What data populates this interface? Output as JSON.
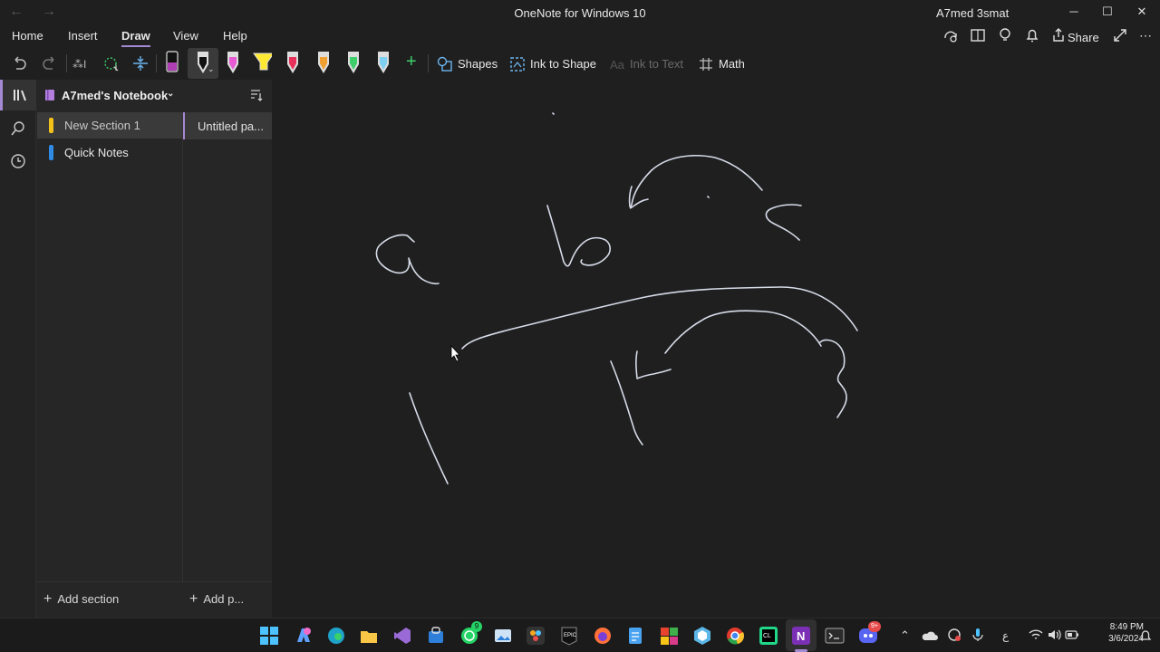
{
  "window": {
    "title": "OneNote for Windows 10",
    "user": "A7med 3smat",
    "back": "←",
    "forward": "→",
    "minimize": "─",
    "maximize": "☐",
    "close": "✕"
  },
  "menu": {
    "tabs": [
      "Home",
      "Insert",
      "Draw",
      "View",
      "Help"
    ],
    "active": "Draw",
    "share_label": "Share"
  },
  "toolbar": {
    "shapes_label": "Shapes",
    "ink_to_shape_label": "Ink to Shape",
    "ink_to_text_label": "Ink to Text",
    "math_label": "Math",
    "pens": [
      {
        "name": "pen-black-purple",
        "color": "#b03fb5"
      },
      {
        "name": "pen-black",
        "color": "#111111"
      },
      {
        "name": "pen-pink",
        "color": "#e85ad4"
      },
      {
        "name": "highlighter-yellow",
        "color": "#ffe933"
      },
      {
        "name": "pen-red",
        "color": "#e8315a"
      },
      {
        "name": "pen-orange",
        "color": "#f0a030"
      },
      {
        "name": "pen-green",
        "color": "#3fcf6a"
      },
      {
        "name": "pen-light-blue",
        "color": "#7fd0f0"
      }
    ]
  },
  "sidebar": {
    "notebook_name": "A7med's Notebook",
    "sections": [
      {
        "label": "New Section 1",
        "color": "#f2c21a",
        "selected": true
      },
      {
        "label": "Quick Notes",
        "color": "#2f8be6",
        "selected": false
      }
    ],
    "pages": [
      {
        "label": "Untitled pa...",
        "selected": true
      }
    ],
    "add_section_label": "Add section",
    "add_page_label": "Add p..."
  },
  "taskbar": {
    "time": "8:49 PM",
    "date": "3/6/2024",
    "whatsapp_badge": "9",
    "discord_badge": "9+",
    "lang": "ع"
  },
  "colors": {
    "accent": "#a489d4",
    "ink": "#d6dbe8",
    "background": "#1f1f1f"
  }
}
